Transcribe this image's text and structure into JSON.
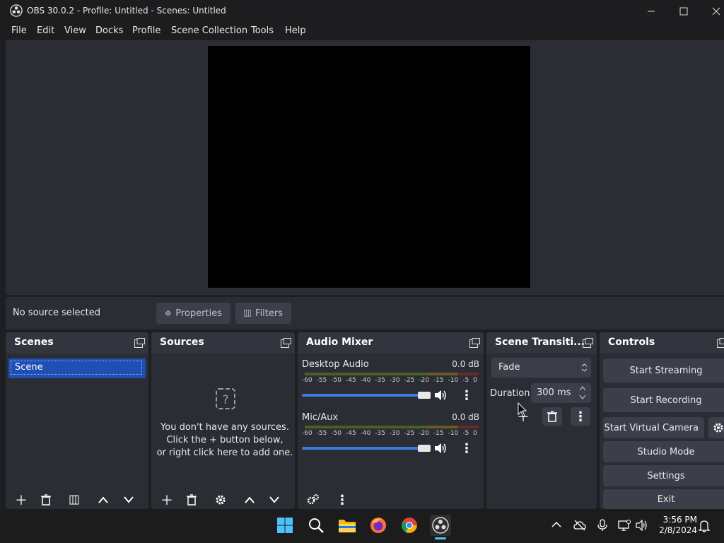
{
  "window": {
    "title": "OBS 30.0.2 - Profile: Untitled - Scenes: Untitled"
  },
  "menu": [
    "File",
    "Edit",
    "View",
    "Docks",
    "Profile",
    "Scene Collection",
    "Tools",
    "Help"
  ],
  "context": {
    "status": "No source selected",
    "properties": "Properties",
    "filters": "Filters"
  },
  "scenes": {
    "title": "Scenes",
    "items": [
      "Scene"
    ]
  },
  "sources": {
    "title": "Sources",
    "empty_line1": "You don't have any sources.",
    "empty_line2": "Click the + button below,",
    "empty_line3": "or right click here to add one."
  },
  "audio": {
    "title": "Audio Mixer",
    "scale": [
      "-60",
      "-55",
      "-50",
      "-45",
      "-40",
      "-35",
      "-30",
      "-25",
      "-20",
      "-15",
      "-10",
      "-5",
      "0"
    ],
    "channels": [
      {
        "name": "Desktop Audio",
        "level": "0.0 dB",
        "volume": 1.0
      },
      {
        "name": "Mic/Aux",
        "level": "0.0 dB",
        "volume": 1.0
      }
    ]
  },
  "transitions": {
    "title": "Scene Transiti...",
    "selected": "Fade",
    "duration_label": "Duration",
    "duration_value": "300 ms"
  },
  "controls": {
    "title": "Controls",
    "start_streaming": "Start Streaming",
    "start_recording": "Start Recording",
    "start_virtual_camera": "Start Virtual Camera",
    "studio_mode": "Studio Mode",
    "settings": "Settings",
    "exit": "Exit"
  },
  "taskbar": {
    "time": "3:56 PM",
    "date": "2/8/2024"
  },
  "colors": {
    "accent": "#1f4fb3",
    "panel": "#2b2d35",
    "header": "#33353e",
    "button": "#3c3f4a",
    "slider": "#3d7de0"
  }
}
